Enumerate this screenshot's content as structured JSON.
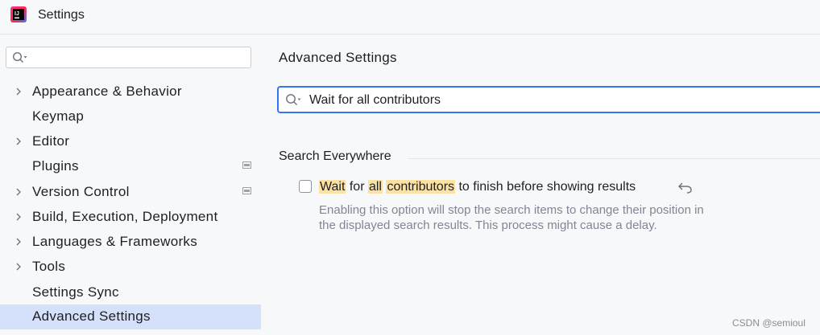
{
  "window": {
    "title": "Settings",
    "app_icon": "intellij-idea-icon"
  },
  "sidebar": {
    "search": {
      "value": "",
      "placeholder": ""
    },
    "items": [
      {
        "label": "Appearance & Behavior",
        "expandable": true
      },
      {
        "label": "Keymap",
        "expandable": false
      },
      {
        "label": "Editor",
        "expandable": true
      },
      {
        "label": "Plugins",
        "expandable": false,
        "badge": "settings-page-icon"
      },
      {
        "label": "Version Control",
        "expandable": true,
        "badge": "settings-page-icon"
      },
      {
        "label": "Build, Execution, Deployment",
        "expandable": true
      },
      {
        "label": "Languages & Frameworks",
        "expandable": true
      },
      {
        "label": "Tools",
        "expandable": true
      },
      {
        "label": "Settings Sync",
        "expandable": false
      },
      {
        "label": "Advanced Settings",
        "expandable": false,
        "selected": true
      }
    ]
  },
  "main": {
    "title": "Advanced Settings",
    "search": {
      "value": "Wait for all contributors"
    },
    "group": {
      "title": "Search Everywhere",
      "option": {
        "checked": false,
        "label_parts": [
          "Wait",
          " for ",
          "all",
          " ",
          "contributors",
          " to finish before showing results"
        ],
        "highlighted": [
          "Wait",
          "all",
          "contributors"
        ],
        "description": "Enabling this option will stop the search items to change their position in the displayed search results. This process might cause a delay."
      }
    }
  },
  "watermark": "CSDN @semioul",
  "colors": {
    "accent": "#3574f0",
    "selection": "#d5e1fb",
    "highlight": "#fbe2a3",
    "description": "#818594"
  }
}
